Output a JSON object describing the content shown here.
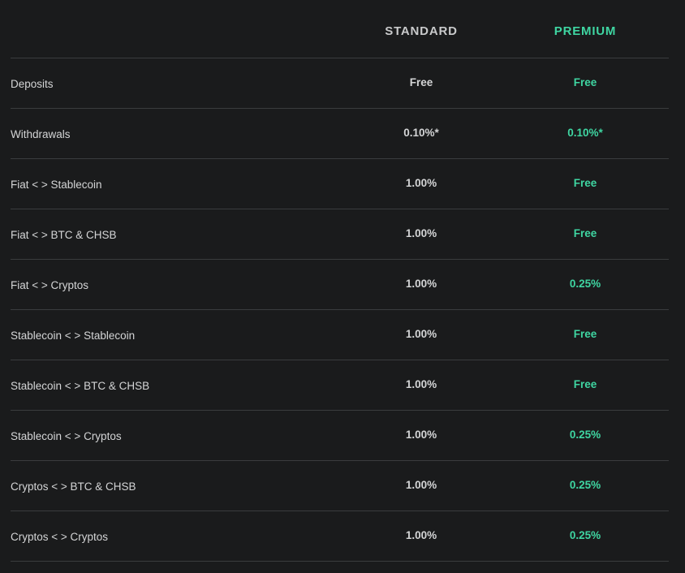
{
  "columns": {
    "standard": "STANDARD",
    "premium": "PREMIUM"
  },
  "rows": [
    {
      "label": "Deposits",
      "standard": "Free",
      "premium": "Free"
    },
    {
      "label": "Withdrawals",
      "standard": "0.10%*",
      "premium": "0.10%*"
    },
    {
      "label": "Fiat < > Stablecoin",
      "standard": "1.00%",
      "premium": "Free"
    },
    {
      "label": "Fiat < > BTC & CHSB",
      "standard": "1.00%",
      "premium": "Free"
    },
    {
      "label": "Fiat < > Cryptos",
      "standard": "1.00%",
      "premium": "0.25%"
    },
    {
      "label": "Stablecoin < > Stablecoin",
      "standard": "1.00%",
      "premium": "Free"
    },
    {
      "label": "Stablecoin < > BTC & CHSB",
      "standard": "1.00%",
      "premium": "Free"
    },
    {
      "label": "Stablecoin < > Cryptos",
      "standard": "1.00%",
      "premium": "0.25%"
    },
    {
      "label": "Cryptos < > BTC & CHSB",
      "standard": "1.00%",
      "premium": "0.25%"
    },
    {
      "label": "Cryptos < > Cryptos",
      "standard": "1.00%",
      "premium": "0.25%"
    }
  ],
  "colors": {
    "background": "#1a1b1c",
    "accent": "#3fd6a2",
    "divider": "#3a3c3e"
  }
}
